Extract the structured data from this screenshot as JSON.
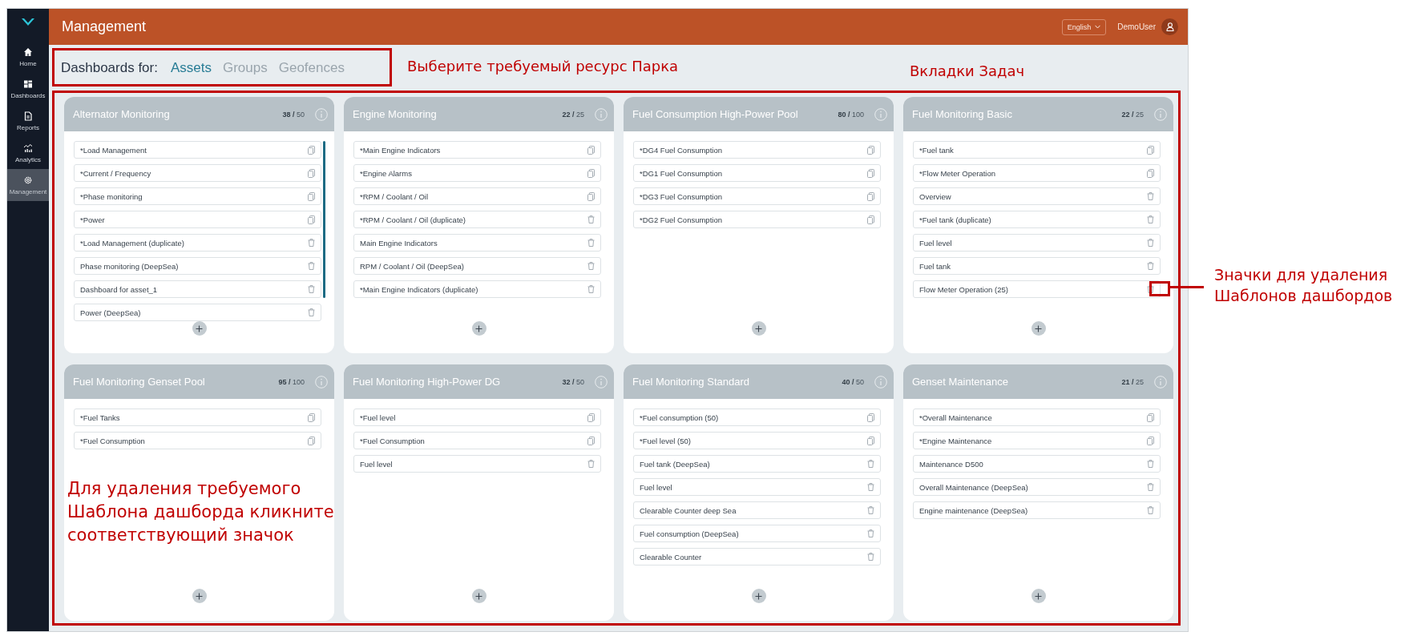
{
  "header": {
    "title": "Management",
    "language": "English",
    "user": "DemoUser"
  },
  "sidebar": {
    "items": [
      {
        "label": "Home",
        "selected": false
      },
      {
        "label": "Dashboards",
        "selected": false
      },
      {
        "label": "Reports",
        "selected": false
      },
      {
        "label": "Analytics",
        "selected": false
      },
      {
        "label": "Management",
        "selected": true
      }
    ]
  },
  "tabs": {
    "label": "Dashboards for:",
    "items": [
      {
        "label": "Assets",
        "selected": true
      },
      {
        "label": "Groups",
        "selected": false
      },
      {
        "label": "Geofences",
        "selected": false
      }
    ]
  },
  "cards": [
    {
      "title": "Alternator Monitoring",
      "count": "38 /",
      "limit": "50",
      "scrollable": true,
      "items": [
        {
          "label": "*Load Management",
          "kind": "copy"
        },
        {
          "label": "*Current / Frequency",
          "kind": "copy"
        },
        {
          "label": "*Phase monitoring",
          "kind": "copy"
        },
        {
          "label": "*Power",
          "kind": "copy"
        },
        {
          "label": "*Load Management (duplicate)",
          "kind": "delete"
        },
        {
          "label": "Phase monitoring (DeepSea)",
          "kind": "delete"
        },
        {
          "label": "Dashboard for asset_1",
          "kind": "delete"
        },
        {
          "label": "Power (DeepSea)",
          "kind": "delete"
        }
      ]
    },
    {
      "title": "Engine Monitoring",
      "count": "22 /",
      "limit": "25",
      "scrollable": false,
      "items": [
        {
          "label": "*Main Engine Indicators",
          "kind": "copy"
        },
        {
          "label": "*Engine Alarms",
          "kind": "copy"
        },
        {
          "label": "*RPM / Coolant / Oil",
          "kind": "copy"
        },
        {
          "label": "*RPM / Coolant / Oil (duplicate)",
          "kind": "delete"
        },
        {
          "label": "Main Engine Indicators",
          "kind": "delete"
        },
        {
          "label": "RPM / Coolant / Oil (DeepSea)",
          "kind": "delete"
        },
        {
          "label": "*Main Engine Indicators (duplicate)",
          "kind": "delete"
        }
      ]
    },
    {
      "title": "Fuel Consumption High-Power Pool",
      "count": "80 /",
      "limit": "100",
      "scrollable": false,
      "items": [
        {
          "label": "*DG4 Fuel Consumption",
          "kind": "copy"
        },
        {
          "label": "*DG1 Fuel Consumption",
          "kind": "copy"
        },
        {
          "label": "*DG3 Fuel Consumption",
          "kind": "copy"
        },
        {
          "label": "*DG2 Fuel Consumption",
          "kind": "copy"
        }
      ]
    },
    {
      "title": "Fuel Monitoring Basic",
      "count": "22 /",
      "limit": "25",
      "scrollable": false,
      "items": [
        {
          "label": "*Fuel tank",
          "kind": "copy"
        },
        {
          "label": "*Flow Meter Operation",
          "kind": "copy"
        },
        {
          "label": "Overview",
          "kind": "delete"
        },
        {
          "label": "*Fuel tank (duplicate)",
          "kind": "delete"
        },
        {
          "label": "Fuel level",
          "kind": "delete"
        },
        {
          "label": "Fuel tank",
          "kind": "delete"
        },
        {
          "label": "Flow Meter Operation (25)",
          "kind": "delete"
        }
      ]
    },
    {
      "title": "Fuel Monitoring Genset Pool",
      "count": "95 /",
      "limit": "100",
      "scrollable": false,
      "items": [
        {
          "label": "*Fuel Tanks",
          "kind": "copy"
        },
        {
          "label": "*Fuel Consumption",
          "kind": "copy"
        }
      ]
    },
    {
      "title": "Fuel Monitoring High-Power DG",
      "count": "32 /",
      "limit": "50",
      "scrollable": false,
      "items": [
        {
          "label": "*Fuel level",
          "kind": "copy"
        },
        {
          "label": "*Fuel Consumption",
          "kind": "copy"
        },
        {
          "label": "Fuel level",
          "kind": "delete"
        }
      ]
    },
    {
      "title": "Fuel Monitoring Standard",
      "count": "40 /",
      "limit": "50",
      "scrollable": false,
      "items": [
        {
          "label": "*Fuel consumption (50)",
          "kind": "copy"
        },
        {
          "label": "*Fuel level (50)",
          "kind": "copy"
        },
        {
          "label": "Fuel tank (DeepSea)",
          "kind": "delete"
        },
        {
          "label": "Fuel level",
          "kind": "delete"
        },
        {
          "label": "Clearable Counter deep Sea",
          "kind": "delete"
        },
        {
          "label": "Fuel consumption (DeepSea)",
          "kind": "delete"
        },
        {
          "label": "Clearable Counter",
          "kind": "delete"
        }
      ]
    },
    {
      "title": "Genset Maintenance",
      "count": "21 /",
      "limit": "25",
      "scrollable": false,
      "items": [
        {
          "label": "*Overall Maintenance",
          "kind": "copy"
        },
        {
          "label": "*Engine Maintenance",
          "kind": "copy"
        },
        {
          "label": "Maintenance D500",
          "kind": "delete"
        },
        {
          "label": "Overall Maintenance (DeepSea)",
          "kind": "delete"
        },
        {
          "label": "Engine maintenance (DeepSea)",
          "kind": "delete"
        }
      ]
    }
  ],
  "annotations": [
    {
      "text": "Выберите требуемый ресурс Парка"
    },
    {
      "text": "Вкладки Задач"
    },
    {
      "text": "Значки для удаления Шаблонов дашбордов"
    },
    {
      "text": "Для удаления требуемого Шаблона дашборда кликните соответствующий значок"
    }
  ]
}
